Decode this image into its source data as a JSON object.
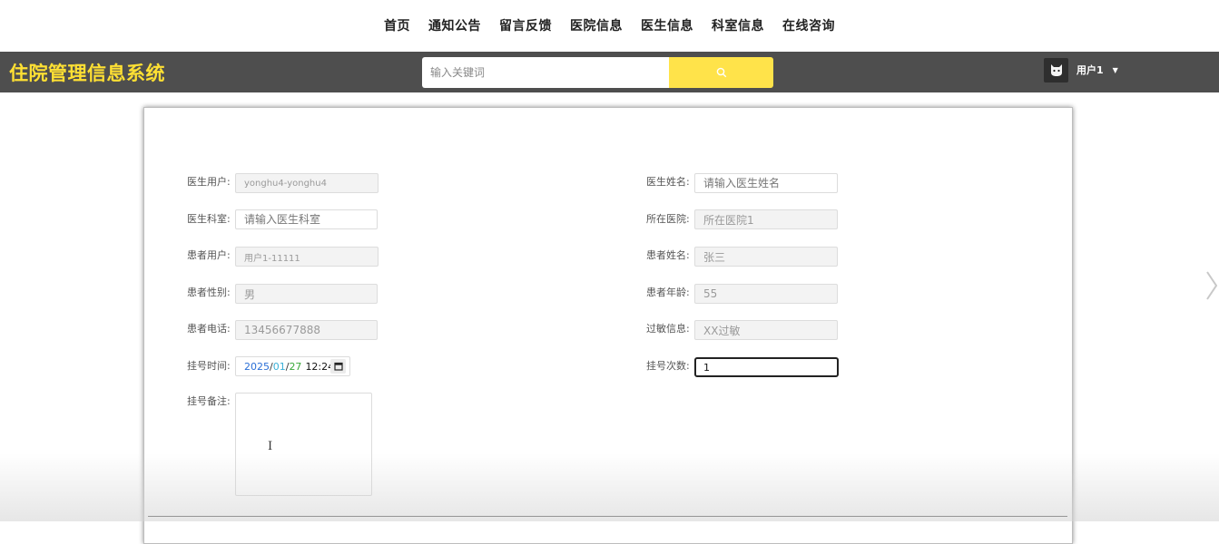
{
  "nav": {
    "items": [
      "首页",
      "通知公告",
      "留言反馈",
      "医院信息",
      "医生信息",
      "科室信息",
      "在线咨询"
    ]
  },
  "header": {
    "title": "住院管理信息系统",
    "search_placeholder": "输入关键词",
    "user_name": "用户1"
  },
  "form": {
    "doctor_user": {
      "label": "医生用户:",
      "value": "yonghu4-yonghu4"
    },
    "doctor_name": {
      "label": "医生姓名:",
      "placeholder": "请输入医生姓名"
    },
    "doctor_dept": {
      "label": "医生科室:",
      "placeholder": "请输入医生科室"
    },
    "hospital": {
      "label": "所在医院:",
      "value": "所在医院1"
    },
    "patient_user": {
      "label": "患者用户:",
      "value": "用户1-11111"
    },
    "patient_name": {
      "label": "患者姓名:",
      "value": "张三"
    },
    "patient_gender": {
      "label": "患者性别:",
      "value": "男"
    },
    "patient_age": {
      "label": "患者年龄:",
      "value": "55"
    },
    "patient_phone": {
      "label": "患者电话:",
      "value": "13456677888"
    },
    "allergy": {
      "label": "过敏信息:",
      "value": "XX过敏"
    },
    "reg_time": {
      "label": "挂号时间:",
      "year": "2025",
      "month": "01",
      "day": "27",
      "time": "12:24"
    },
    "reg_count": {
      "label": "挂号次数:",
      "value": "1"
    },
    "reg_note": {
      "label": "挂号备注:",
      "value": ""
    }
  },
  "colors": {
    "accent_yellow": "#ffe034",
    "header_bg": "#4e4e4e"
  },
  "icons": {
    "search": "search-icon",
    "avatar": "cat-avatar-icon",
    "calendar": "calendar-icon",
    "next": "chevron-right-icon"
  }
}
